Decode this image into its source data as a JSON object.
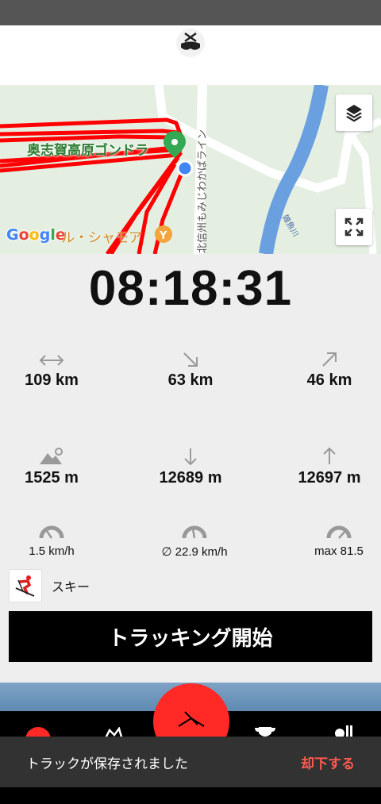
{
  "map": {
    "place_label": "奥志賀高原ゴンドラ",
    "road_label": "北信州もみじわかばライン",
    "river_label": "雑魚川",
    "poi_label": "ル・シャモア",
    "attribution": [
      "G",
      "o",
      "o",
      "g",
      "l",
      "e"
    ],
    "colors": {
      "track": "#ff0000",
      "marker": "#34a853",
      "location": "#4285f4",
      "river": "#6a9fe0"
    }
  },
  "timer": "08:18:31",
  "stats": {
    "total_distance": "109 km",
    "downhill_distance": "63 km",
    "uphill_distance": "46 km",
    "altitude": "1525 m",
    "descent": "12689 m",
    "ascent": "12697 m",
    "speed_current": "1.5 km/h",
    "speed_avg": "∅ 22.9 km/h",
    "speed_max": "max 81.5"
  },
  "activity": {
    "label": "スキー",
    "icon": "skier-icon"
  },
  "start_button": {
    "label": "トラッキング開始"
  },
  "snackbar": {
    "message": "トラックが保存されました",
    "action": "却下する"
  },
  "colors": {
    "accent": "#ff2a25",
    "dark": "#000000",
    "background": "#eeeeee"
  }
}
